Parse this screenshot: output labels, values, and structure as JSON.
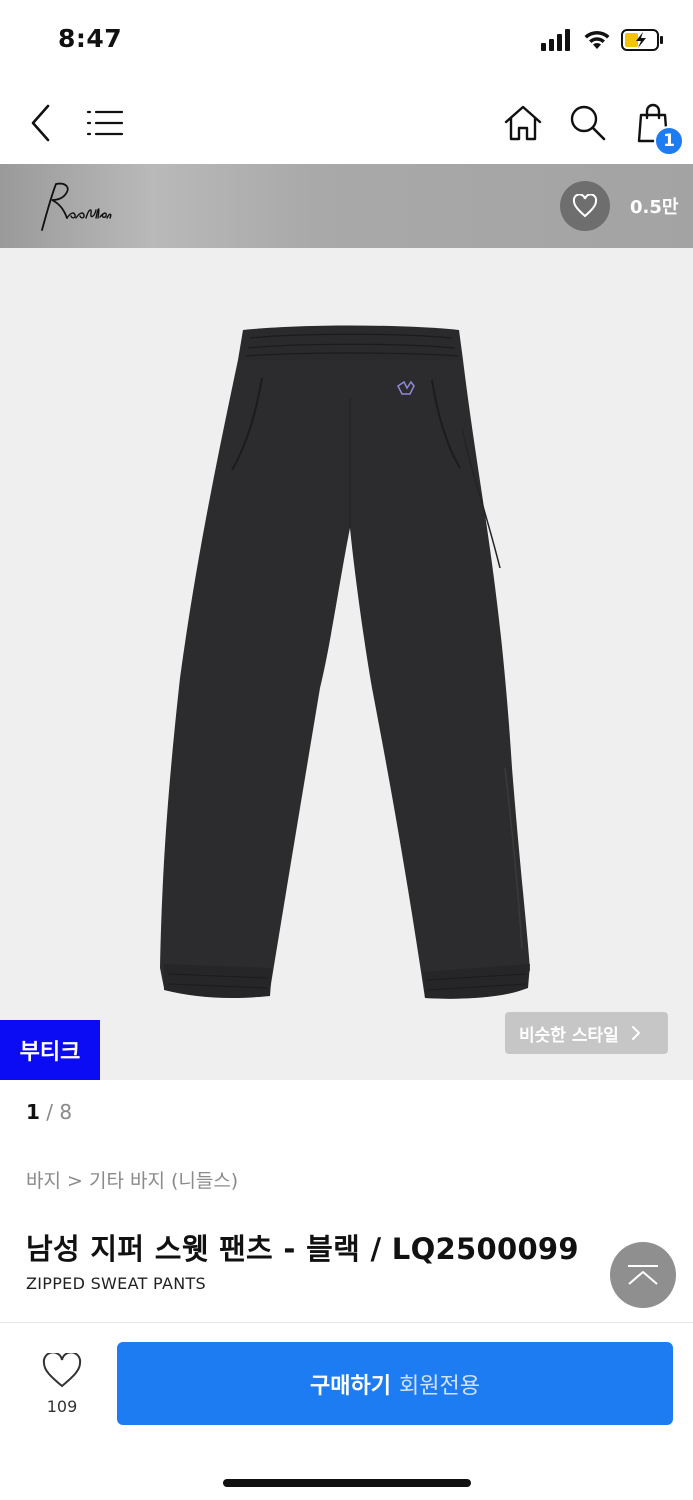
{
  "status_bar": {
    "time": "8:47"
  },
  "nav": {
    "icons": [
      "back-icon",
      "menu-icon",
      "home-icon",
      "search-icon",
      "cart-icon"
    ],
    "cart_count": "1"
  },
  "brand": {
    "logo_text": "Needles",
    "like_count": "0.5만"
  },
  "gallery": {
    "boutique_tag": "부티크",
    "similar_label": "비슷한 스타일",
    "current_page": "1",
    "separator": " / ",
    "total_pages": "8"
  },
  "product": {
    "breadcrumb": "바지 > 기타 바지 (니들스)",
    "title": "남성 지퍼 스웻 팬츠 - 블랙 / LQ2500099",
    "subtitle": "ZIPPED SWEAT PANTS"
  },
  "bottom": {
    "wish_count": "109",
    "buy_label": "구매하기",
    "buy_note": "회원전용"
  },
  "colors": {
    "accent": "#1e7cf2",
    "boutique": "#0b0bf4",
    "product_bg": "#efefef",
    "garment": "#2c2c2e"
  }
}
